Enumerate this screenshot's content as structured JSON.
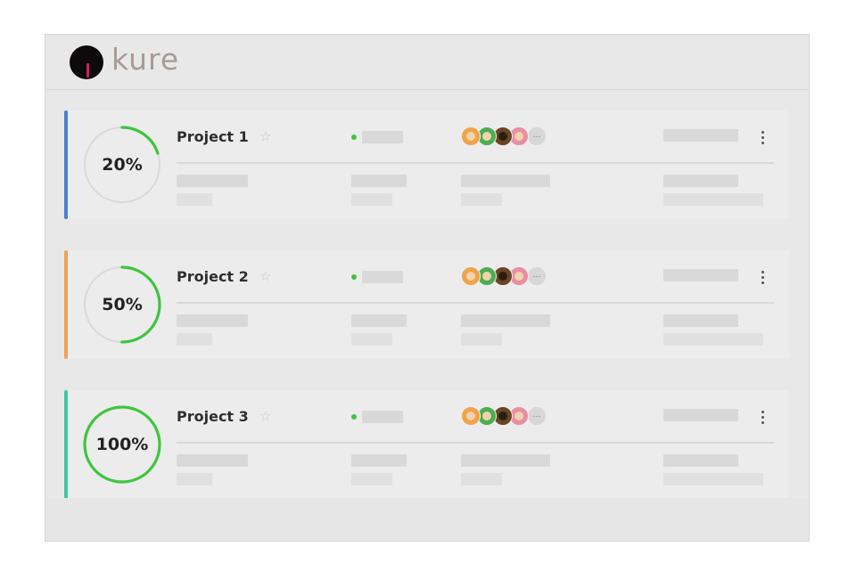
{
  "app": {
    "brand": "kure"
  },
  "colors": {
    "progress_ring": "#3ec53e",
    "ring_track": "#d9d9d9",
    "status_dot": "#3ec53e",
    "logo_mark": "#0d0a0c",
    "logo_stem": "#d61c55",
    "logo_text": "#a89a97"
  },
  "icons": {
    "star": "☆",
    "more_members": "…"
  },
  "projects": [
    {
      "title": "Project 1",
      "progress_label": "20%",
      "progress": 0.2,
      "accent_color": "#4a7fd4",
      "favorite": false,
      "avatars": [
        "#f0a34a",
        "#4cae52",
        "#6b4424",
        "#e88ea2"
      ]
    },
    {
      "title": "Project 2",
      "progress_label": "50%",
      "progress": 0.5,
      "accent_color": "#f0a05a",
      "favorite": false,
      "avatars": [
        "#f0a34a",
        "#4cae52",
        "#6b4424",
        "#e88ea2"
      ]
    },
    {
      "title": "Project 3",
      "progress_label": "100%",
      "progress": 1.0,
      "accent_color": "#3ec6a8",
      "favorite": false,
      "avatars": [
        "#f0a34a",
        "#4cae52",
        "#6b4424",
        "#e88ea2"
      ]
    }
  ]
}
